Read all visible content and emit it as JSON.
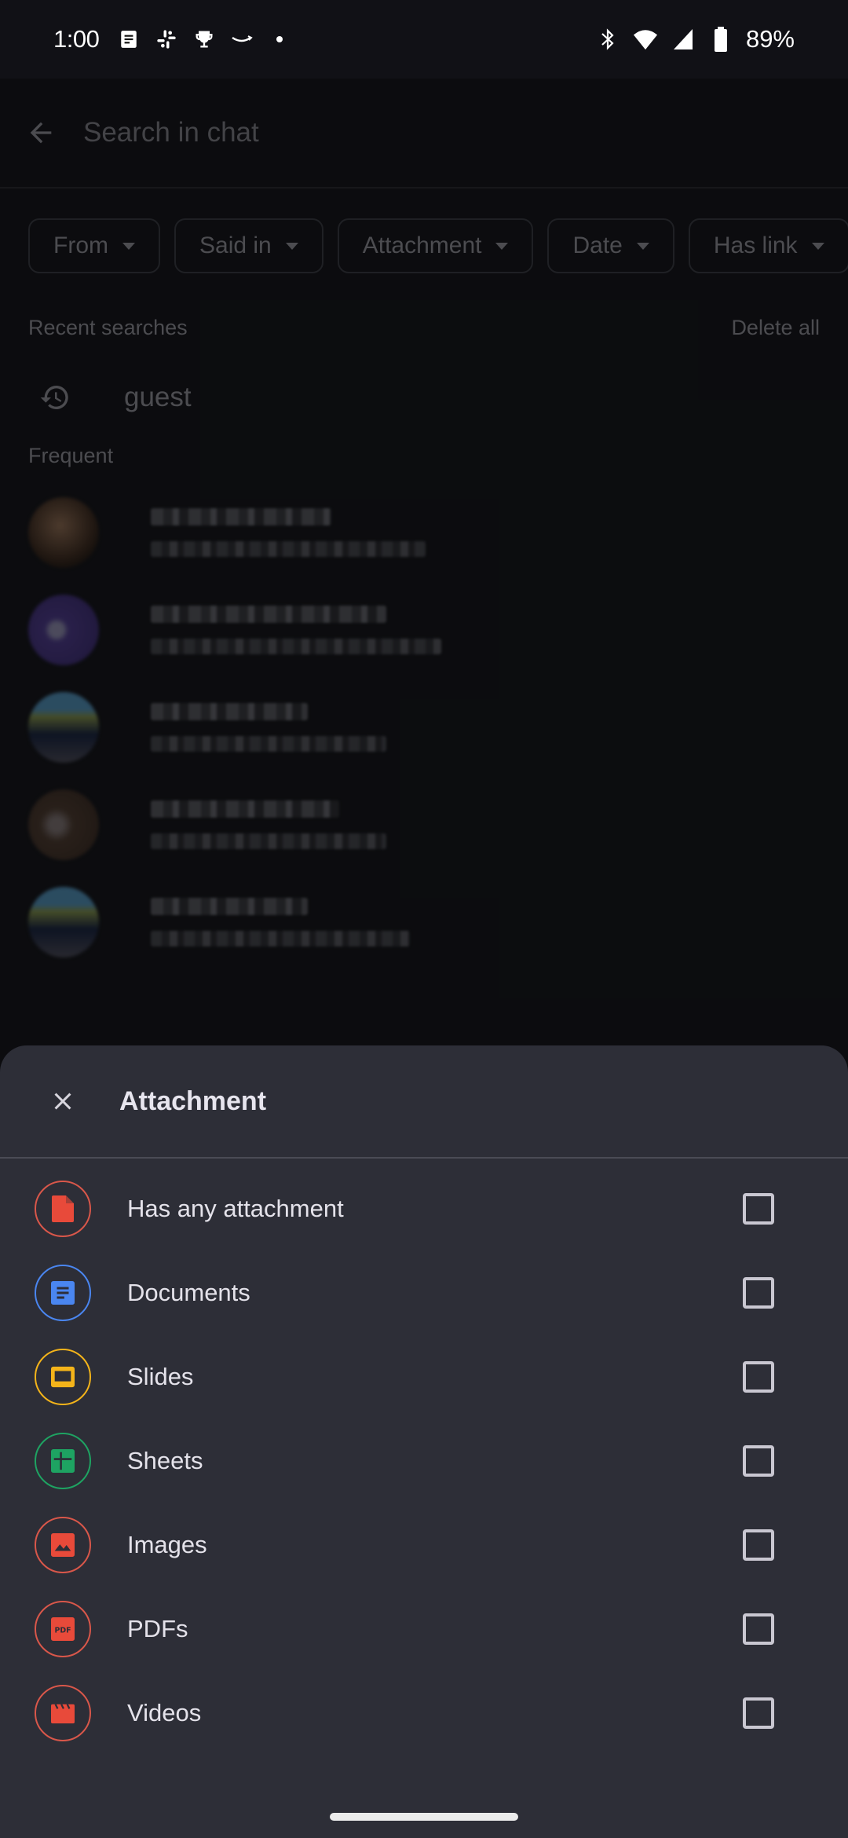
{
  "status_bar": {
    "time": "1:00",
    "left_icons": [
      "news-icon",
      "slack-icon",
      "trophy-icon",
      "amazon-icon",
      "dot-icon"
    ],
    "right_icons": [
      "bluetooth-icon",
      "wifi-icon",
      "cell-signal-icon",
      "battery-icon"
    ],
    "battery_percent": "89%"
  },
  "search": {
    "placeholder": "Search in chat",
    "value": ""
  },
  "filter_chips": [
    {
      "label": "From"
    },
    {
      "label": "Said in"
    },
    {
      "label": "Attachment"
    },
    {
      "label": "Date"
    },
    {
      "label": "Has link"
    }
  ],
  "recent": {
    "heading": "Recent searches",
    "delete_all": "Delete all",
    "items": [
      {
        "query": "guest"
      }
    ]
  },
  "frequent": {
    "heading": "Frequent",
    "contacts": [
      {
        "avatar_color": "#6b4a34"
      },
      {
        "avatar_color": "#4b3a86"
      },
      {
        "avatar_color": "#6d7a4a"
      },
      {
        "avatar_color": "#4a3a30"
      },
      {
        "avatar_color": "#6d7a4a"
      }
    ]
  },
  "sheet": {
    "title": "Attachment",
    "close_label": "Close",
    "options": [
      {
        "label": "Has any attachment",
        "icon": "file-icon",
        "color": "#e84a3a",
        "checked": false
      },
      {
        "label": "Documents",
        "icon": "docs-icon",
        "color": "#4a86f0",
        "checked": false
      },
      {
        "label": "Slides",
        "icon": "slides-icon",
        "color": "#f4b41a",
        "checked": false
      },
      {
        "label": "Sheets",
        "icon": "sheets-icon",
        "color": "#1ea362",
        "checked": false
      },
      {
        "label": "Images",
        "icon": "image-icon",
        "color": "#e84a3a",
        "checked": false
      },
      {
        "label": "PDFs",
        "icon": "pdf-icon",
        "color": "#e84a3a",
        "checked": false
      },
      {
        "label": "Videos",
        "icon": "video-icon",
        "color": "#e84a3a",
        "checked": false
      }
    ]
  }
}
